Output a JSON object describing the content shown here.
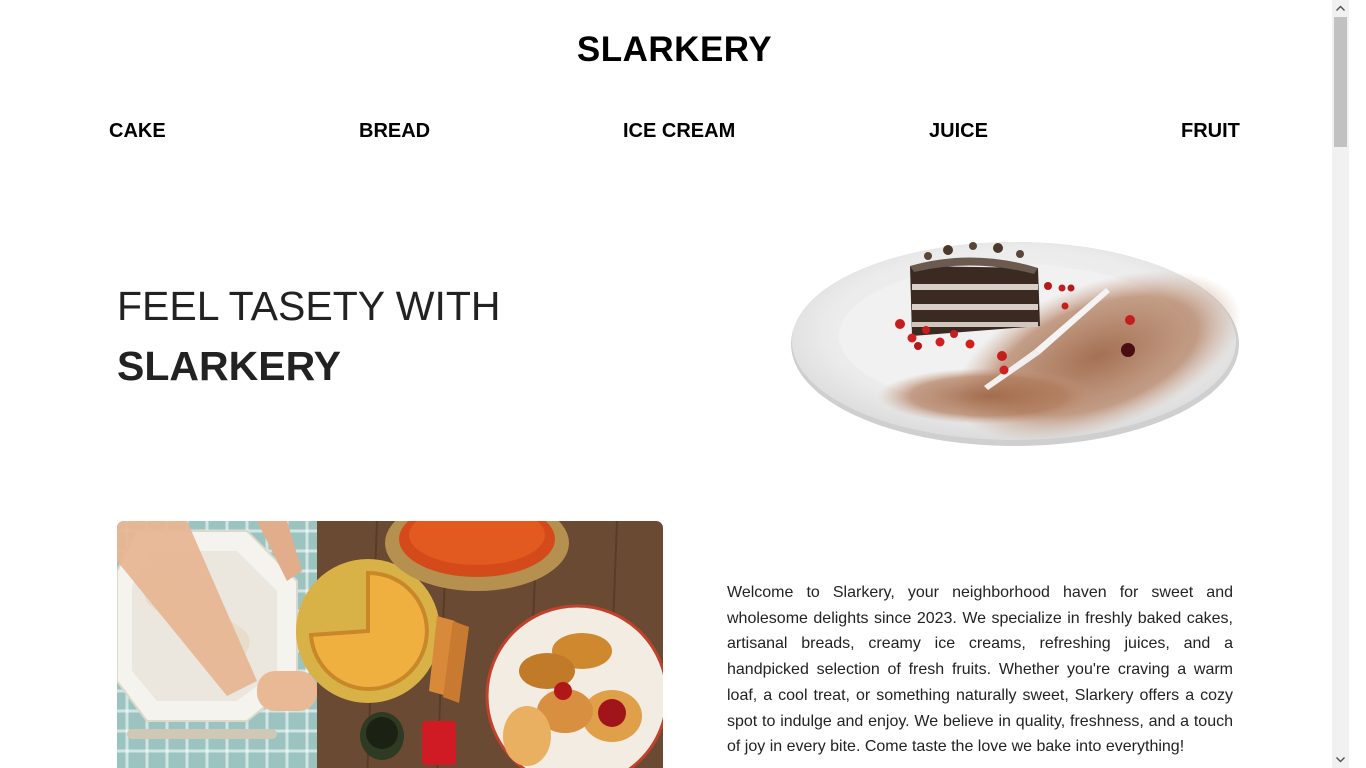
{
  "header": {
    "site_title": "SLARKERY"
  },
  "nav": {
    "items": [
      {
        "label": "CAKE"
      },
      {
        "label": "BREAD"
      },
      {
        "label": "ICE CREAM"
      },
      {
        "label": "JUICE"
      },
      {
        "label": "FRUIT"
      }
    ]
  },
  "hero": {
    "line1": "FEEL TASETY WITH",
    "line2": "SLARKERY"
  },
  "about": {
    "text": "Welcome to Slarkery, your neighborhood haven for sweet and wholesome delights since 2023. We specialize in freshly baked cakes, artisanal breads, creamy ice creams, refreshing juices, and a handpicked selection of fresh fruits. Whether you're craving a warm loaf, a cool treat, or something naturally sweet, Slarkery offers a cozy spot to indulge and enjoy. We believe in quality, freshness, and a touch of joy in every bite. Come taste the love we bake into everything!"
  },
  "colors": {
    "text": "#222222",
    "nav": "#000000",
    "background": "#ffffff",
    "scrollbar_track": "#f1f1f1",
    "scrollbar_thumb": "#c1c1c1"
  }
}
